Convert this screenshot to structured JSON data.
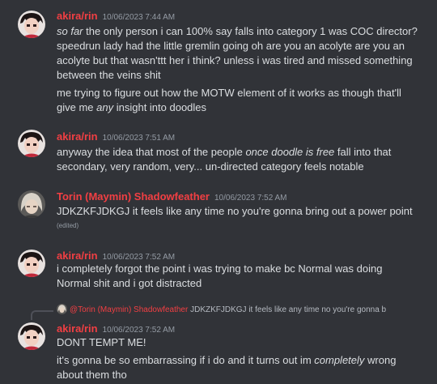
{
  "colors": {
    "background": "#313338",
    "author_name": "#f23f43",
    "timestamp": "#949ba4",
    "text": "#dbdee1"
  },
  "messages": [
    {
      "author": "akira/rin",
      "timestamp": "10/06/2023 7:44 AM",
      "avatar": "akira-avatar",
      "lines": [
        {
          "pre": "",
          "em": "so far",
          "post": " the only person i can 100% say falls into category 1 was COC director?"
        },
        {
          "pre": "speedrun lady had the little gremlin going oh are you an acolyte are you an",
          "em": "",
          "post": ""
        },
        {
          "pre": "acolyte but that wasn'ttt her i think? unless i was tired and missed something",
          "em": "",
          "post": ""
        },
        {
          "pre": "between the veins shit",
          "em": "",
          "post": ""
        },
        {
          "pre": "me trying to figure out how the MOTW element of it works as though that'll",
          "em": "",
          "post": ""
        },
        {
          "pre": "give me ",
          "em": "any",
          "post": " insight into doodles"
        }
      ]
    },
    {
      "author": "akira/rin",
      "timestamp": "10/06/2023 7:51 AM",
      "avatar": "akira-avatar",
      "lines": [
        {
          "pre": "anyway the idea that most of the people ",
          "em": "once doodle is free",
          "post": " fall into that"
        },
        {
          "pre": "secondary, very random, very... un-directed category feels notable",
          "em": "",
          "post": ""
        }
      ]
    },
    {
      "author": "Torin (Maymin) Shadowfeather",
      "timestamp": "10/06/2023 7:52 AM",
      "avatar": "torin-avatar",
      "lines": [
        {
          "pre": "JDKZKFJDKGJ it feels like any time no you're gonna bring out a power point",
          "em": "",
          "post": ""
        }
      ],
      "edited": "(edited)"
    },
    {
      "author": "akira/rin",
      "timestamp": "10/06/2023 7:52 AM",
      "avatar": "akira-avatar",
      "lines": [
        {
          "pre": "i completely forgot the point i was trying to make bc Normal was doing",
          "em": "",
          "post": ""
        },
        {
          "pre": "Normal shit and i got distracted",
          "em": "",
          "post": ""
        }
      ]
    },
    {
      "author": "akira/rin",
      "timestamp": "10/06/2023 7:52 AM",
      "avatar": "akira-avatar",
      "reply": {
        "author": "@Torin (Maymin) Shadowfeather",
        "preview": "JDKZKFJDKGJ it feels like any time no you're gonna b"
      },
      "lines": [
        {
          "pre": "DONT TEMPT ME!",
          "em": "",
          "post": ""
        },
        {
          "pre": "it's gonna be so embarrassing if i do and it turns out im ",
          "em": "completely",
          "post": " wrong"
        },
        {
          "pre": "about them tho",
          "em": "",
          "post": ""
        }
      ]
    }
  ]
}
